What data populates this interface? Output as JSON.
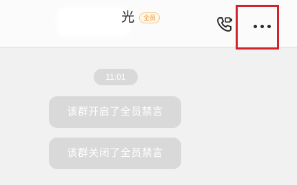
{
  "header": {
    "title_visible": "光",
    "badge": "全员",
    "call_icon": "video-call-icon",
    "more_icon": "more-dots-icon",
    "highlight_color": "#d1232a"
  },
  "chat": {
    "time": "11:01",
    "system_messages": [
      "该群开启了全员禁言",
      "该群关闭了全员禁言"
    ]
  }
}
